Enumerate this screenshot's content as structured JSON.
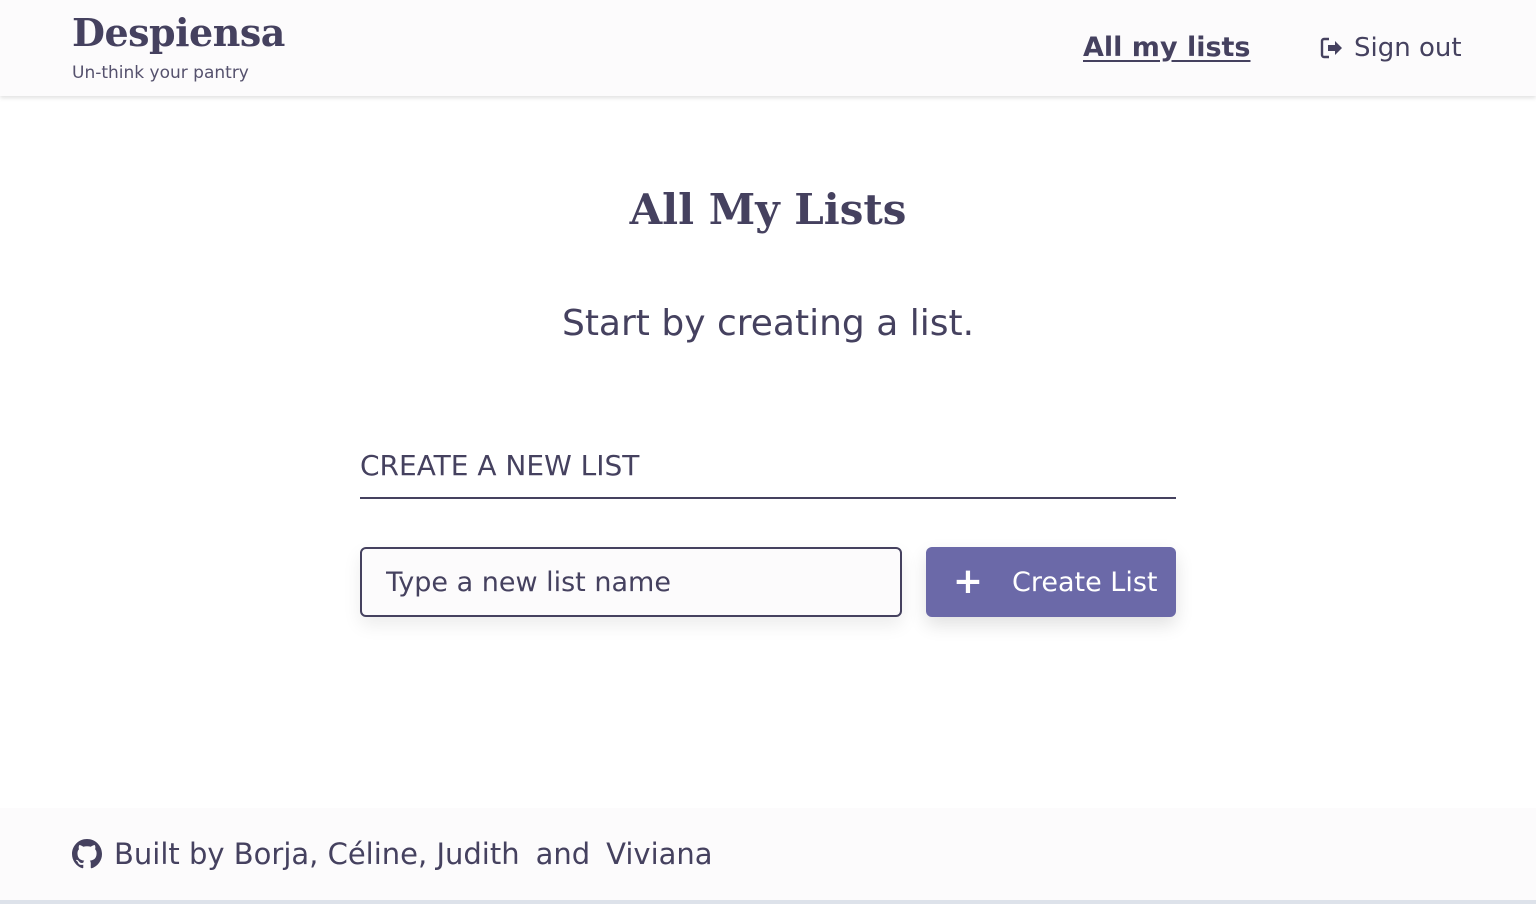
{
  "header": {
    "brand_title": "Despiensa",
    "brand_tagline": "Un-think your pantry",
    "nav_all_lists": "All my lists",
    "nav_sign_out": "Sign out"
  },
  "main": {
    "title": "All My Lists",
    "empty_message": "Start by creating a list.",
    "section_title": "CREATE A NEW LIST",
    "input_placeholder": "Type a new list name",
    "input_value": "",
    "create_button_icon": "+",
    "create_button_label": "Create List"
  },
  "footer": {
    "built_by": "Built by Borja, Céline, Judith",
    "and": "and",
    "last_author": "Viviana"
  },
  "icons": {
    "sign_out": "sign-out-icon",
    "github": "github-icon",
    "plus": "plus-icon"
  },
  "colors": {
    "text": "#45415f",
    "accent": "#6b69a8",
    "header_bg": "#fcfbfc"
  }
}
